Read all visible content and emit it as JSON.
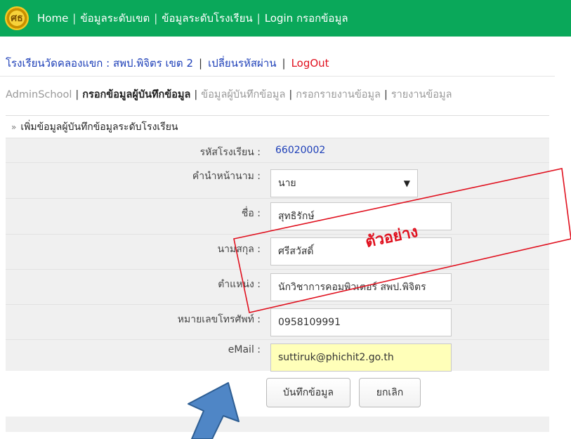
{
  "topnav": {
    "logo_text": "ศธ",
    "items": [
      {
        "label": "Home"
      },
      {
        "label": "ข้อมูลระดับเขต"
      },
      {
        "label": "ข้อมูลระดับโรงเรียน"
      },
      {
        "label": "Login กรอกข้อมูล"
      }
    ]
  },
  "user_line": {
    "school": "โรงเรียนวัดคลองแขก : สพป.พิจิตร เขต 2",
    "change_password": "เปลี่ยนรหัสผ่าน",
    "logout": "LogOut"
  },
  "admin_menu": {
    "items": [
      {
        "label": "AdminSchool",
        "active": false
      },
      {
        "label": "กรอกข้อมูลผู้บันทึกข้อมูล",
        "active": true
      },
      {
        "label": "ข้อมูลผู้บันทึกข้อมูล",
        "active": false
      },
      {
        "label": "กรอกรายงานข้อมูล",
        "active": false
      },
      {
        "label": "รายงานข้อมูล",
        "active": false
      }
    ]
  },
  "form": {
    "title": "เพิ่มข้อมูลผู้บันทึกข้อมูลระดับโรงเรียน",
    "school_code_label": "รหัสโรงเรียน :",
    "school_code_value": "66020002",
    "prefix_label": "คำนำหน้านาม :",
    "prefix_value": "นาย",
    "first_name_label": "ชื่อ :",
    "first_name_value": "สุทธิรักษ์",
    "last_name_label": "นามสกุล :",
    "last_name_value": "ศรีสวัสดิ์",
    "position_label": "ตำแหน่ง :",
    "position_value": "นักวิชาการคอมพิวเตอร์ สพป.พิจิตร",
    "phone_label": "หมายเลขโทรศัพท์ :",
    "phone_value": "0958109991",
    "email_label": "eMail :",
    "email_value": "suttiruk@phichit2.go.th",
    "save_button": "บันทึกข้อมูล",
    "cancel_button": "ยกเลิก"
  },
  "annotation": {
    "stamp_text": "ตัวอย่าง",
    "stamp_color": "#e0101e",
    "arrow_color": "#4f86c6"
  }
}
